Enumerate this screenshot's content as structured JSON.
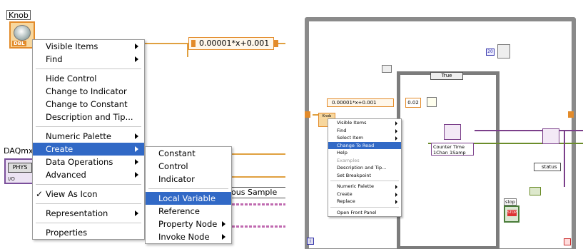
{
  "left_panel": {
    "knob_label": "Knob",
    "knob_type_tag": "DBL",
    "expression": "0.00001*x+0.001",
    "daq_label": "DAQmx",
    "daq_button": "PHYS",
    "daq_io_tag": "I/O",
    "partial_label": "ious Sample",
    "context_menu": {
      "items": [
        {
          "label": "Visible Items",
          "submenu": true
        },
        {
          "label": "Find",
          "submenu": true
        },
        {
          "separator": true
        },
        {
          "label": "Hide Control"
        },
        {
          "label": "Change to Indicator"
        },
        {
          "label": "Change to Constant"
        },
        {
          "label": "Description and Tip..."
        },
        {
          "separator": true
        },
        {
          "label": "Numeric Palette",
          "submenu": true
        },
        {
          "label": "Create",
          "submenu": true,
          "highlighted": true
        },
        {
          "label": "Data Operations",
          "submenu": true
        },
        {
          "label": "Advanced",
          "submenu": true
        },
        {
          "separator": true
        },
        {
          "label": "View As Icon",
          "checked": true
        },
        {
          "separator": true
        },
        {
          "label": "Representation",
          "submenu": true
        },
        {
          "separator": true
        },
        {
          "label": "Properties"
        }
      ]
    },
    "create_submenu": {
      "items": [
        {
          "label": "Constant"
        },
        {
          "label": "Control"
        },
        {
          "label": "Indicator"
        },
        {
          "separator": true
        },
        {
          "label": "Local Variable",
          "highlighted": true
        },
        {
          "label": "Reference"
        },
        {
          "label": "Property Node",
          "submenu": true
        },
        {
          "label": "Invoke Node",
          "submenu": true
        }
      ]
    },
    "checkmark": "✓"
  },
  "right_panel": {
    "case_selector": "True",
    "expression": "0.00001*x+0.001",
    "constant": "0.02",
    "knob_tag": "Knob",
    "counter_text": "Counter Time 1Chan 1Samp",
    "status_label": "status",
    "stop_label": "stop",
    "stop_button_text": "STOP",
    "iteration": "i",
    "loop_count": "20",
    "context_menu": {
      "items": [
        {
          "label": "Visible Items",
          "submenu": true
        },
        {
          "label": "Find",
          "submenu": true
        },
        {
          "label": "Select Item",
          "submenu": true
        },
        {
          "label": "Change To Read",
          "highlighted": true
        },
        {
          "label": "Help"
        },
        {
          "label": "Examples",
          "disabled": true
        },
        {
          "label": "Description and Tip..."
        },
        {
          "label": "Set Breakpoint"
        },
        {
          "separator": true
        },
        {
          "label": "Numeric Palette",
          "submenu": true
        },
        {
          "label": "Create",
          "submenu": true
        },
        {
          "label": "Replace",
          "submenu": true
        },
        {
          "separator": true
        },
        {
          "label": "Open Front Panel"
        }
      ]
    }
  },
  "colors": {
    "highlight": "#3169c6",
    "wire_orange": "#e0a040",
    "wire_pink": "#d66fb0",
    "wire_purple": "#7b3f8a",
    "wire_green": "#6b8d2a",
    "frame_gray": "#8a8a8a"
  }
}
